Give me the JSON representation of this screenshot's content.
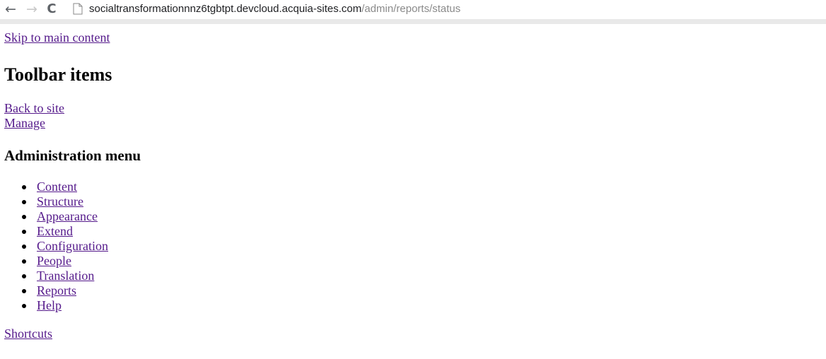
{
  "browser": {
    "back_glyph": "←",
    "forward_glyph": "→",
    "reload_glyph": "C",
    "url_host": "socialtransformationnnz6tgbtpt.devcloud.acquia-sites.com",
    "url_path": "/admin/reports/status"
  },
  "page": {
    "skip_link": "Skip to main content",
    "toolbar_heading": "Toolbar items",
    "toolbar_links": [
      {
        "label": "Back to site"
      },
      {
        "label": "Manage"
      }
    ],
    "admin_heading": "Administration menu",
    "admin_menu": [
      {
        "label": "Content"
      },
      {
        "label": "Structure"
      },
      {
        "label": "Appearance"
      },
      {
        "label": "Extend"
      },
      {
        "label": "Configuration"
      },
      {
        "label": "People"
      },
      {
        "label": "Translation"
      },
      {
        "label": "Reports"
      },
      {
        "label": "Help"
      }
    ],
    "shortcuts_link": "Shortcuts"
  },
  "colors": {
    "visited_link": "#551a8b",
    "chrome_strip": "#e9e9e9",
    "url_path": "#8a8a8a"
  }
}
